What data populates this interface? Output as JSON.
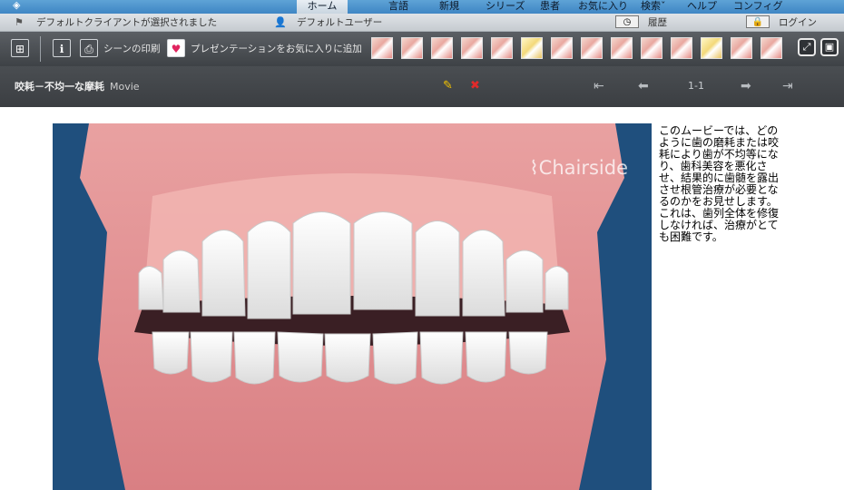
{
  "nav": {
    "items": [
      "ホーム",
      "言語",
      "新規",
      "シリーズ",
      "患者",
      "お気に入り",
      "検索",
      "ヘルプ",
      "コンフィグ"
    ]
  },
  "status": {
    "client": "デフォルトクライアントが選択されました",
    "user": "デフォルトユーザー",
    "history": "履歴",
    "login": "ログイン"
  },
  "toolbar": {
    "print_label": "シーンの印刷",
    "favorite_label": "プレゼンテーションをお気に入りに追加"
  },
  "title": {
    "main": "咬耗－不均一な摩耗",
    "type": "Movie",
    "page": "1-1"
  },
  "video": {
    "watermark": "Chairside"
  },
  "description": "このムービーでは、どのように歯の磨耗または咬耗により歯が不均等になり、歯科美容を悪化させ、結果的に歯髄を露出させ根管治療が必要となるのかをお見せします。これは、歯列全体を修復しなければ、治療がとても困難です。",
  "icons": {
    "logo": "chairside-logo-icon",
    "flag": "flag-icon",
    "user": "user-icon",
    "history": "clock-icon",
    "login": "lock-icon",
    "grid": "grid-icon",
    "info": "info-icon",
    "print": "print-icon",
    "heart": "heart-icon",
    "expand": "expand-icon",
    "camera": "camera-icon",
    "pencil": "pencil-icon",
    "delete": "delete-icon"
  },
  "colors": {
    "accent_blue": "#3f86c4",
    "toolbar": "#4b4f54",
    "heart": "#e0245e",
    "pencil": "#f5c400",
    "delete": "#e12a2a"
  }
}
